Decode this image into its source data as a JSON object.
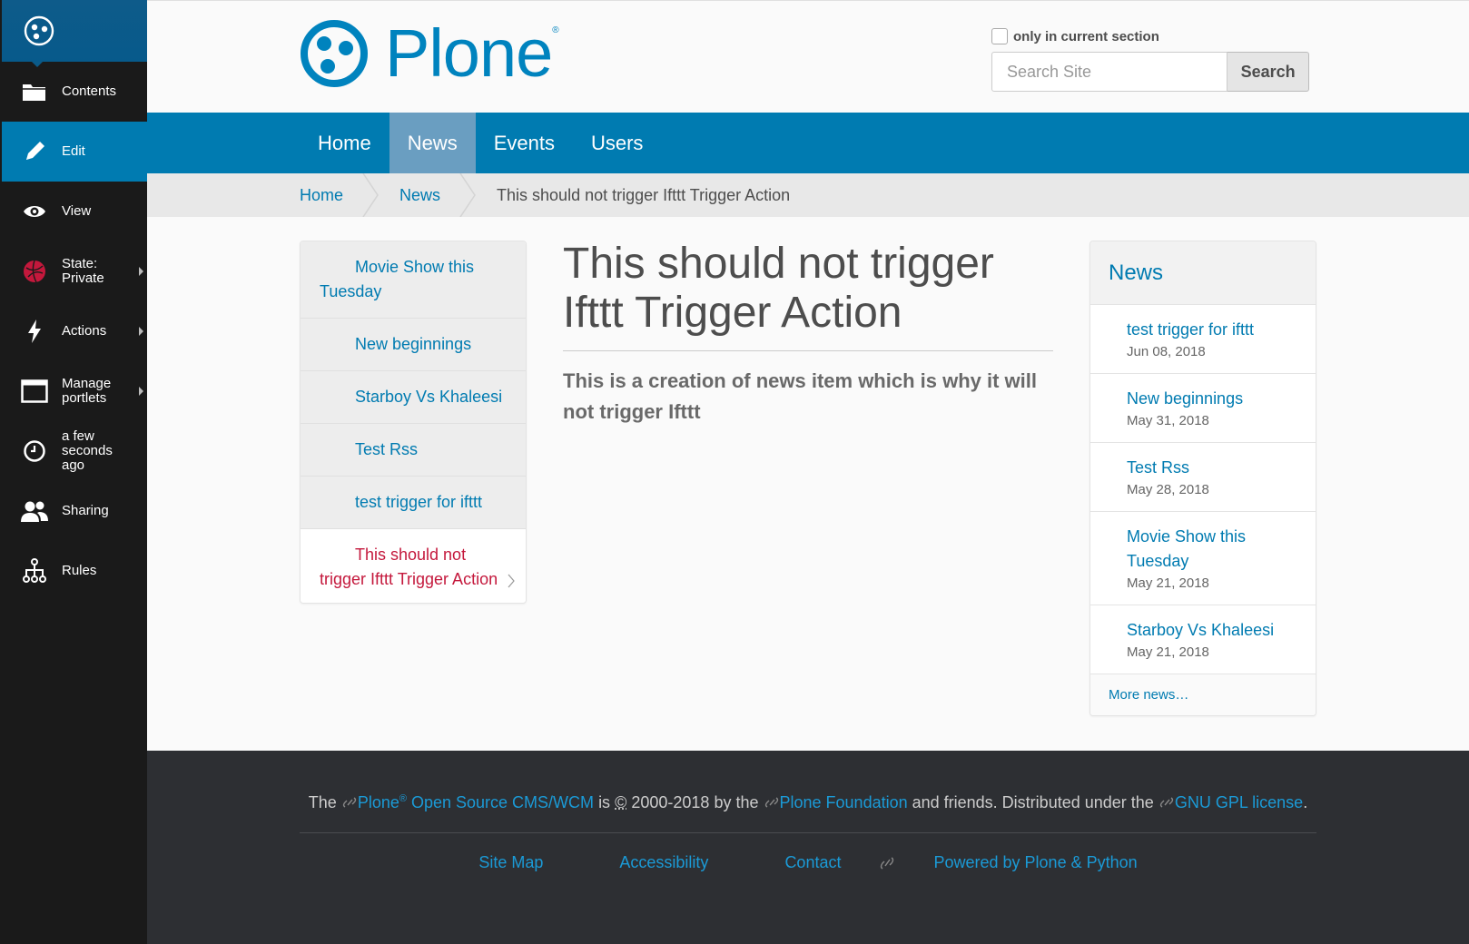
{
  "toolbar": {
    "items": [
      {
        "label": "Contents",
        "icon": "folder-icon"
      },
      {
        "label": "Edit",
        "icon": "pencil-icon"
      },
      {
        "label": "View",
        "icon": "eye-icon"
      },
      {
        "label_line1": "State:",
        "label_line2": "Private",
        "icon": "state-icon"
      },
      {
        "label": "Actions",
        "icon": "lightning-icon"
      },
      {
        "label_line1": "Manage",
        "label_line2": "portlets",
        "icon": "window-icon"
      },
      {
        "label_line1": "a few",
        "label_line2": "seconds",
        "label_line3": "ago",
        "icon": "clock-icon"
      },
      {
        "label": "Sharing",
        "icon": "people-icon"
      },
      {
        "label": "Rules",
        "icon": "rules-icon"
      }
    ]
  },
  "header": {
    "logo_text": "Plone",
    "logo_mark": "®",
    "search": {
      "checkbox_label": "only in current section",
      "placeholder": "Search Site",
      "button": "Search"
    }
  },
  "nav": {
    "tabs": [
      "Home",
      "News",
      "Events",
      "Users"
    ]
  },
  "breadcrumb": {
    "home": "Home",
    "section": "News",
    "current": "This should not trigger Ifttt Trigger Action"
  },
  "leftnav": {
    "items": [
      "Movie Show this Tuesday",
      "New beginnings",
      "Starboy Vs Khaleesi",
      "Test Rss",
      "test trigger for ifttt",
      "This should not trigger Ifttt Trigger Action"
    ]
  },
  "main": {
    "title": "This should not trigger Ifttt Trigger Action",
    "description": "This is a creation of news item which is why it will not trigger Ifttt"
  },
  "news_portlet": {
    "title": "News",
    "items": [
      {
        "title": "test trigger for ifttt",
        "date": "Jun 08, 2018"
      },
      {
        "title": "New beginnings",
        "date": "May 31, 2018"
      },
      {
        "title": "Test Rss",
        "date": "May 28, 2018"
      },
      {
        "title": "Movie Show this Tuesday",
        "date": "May 21, 2018"
      },
      {
        "title": "Starboy Vs Khaleesi",
        "date": "May 21, 2018"
      }
    ],
    "more": "More news…"
  },
  "footer": {
    "the": "The",
    "plone": "Plone",
    "reg": "®",
    "cms": "Open Source CMS/WCM",
    "is": "is",
    "copy": "©",
    "years": "2000-2018 by the",
    "foundation": "Plone Foundation",
    "friends": "and friends. Distributed under the",
    "gpl": "GNU GPL license",
    "period": ".",
    "links": [
      "Site Map",
      "Accessibility",
      "Contact",
      "Powered by Plone & Python"
    ]
  },
  "colors": {
    "brand": "#007bb1",
    "toolbar": "#1a1a1a",
    "current": "#c4183c",
    "footer": "#2d2f33"
  }
}
